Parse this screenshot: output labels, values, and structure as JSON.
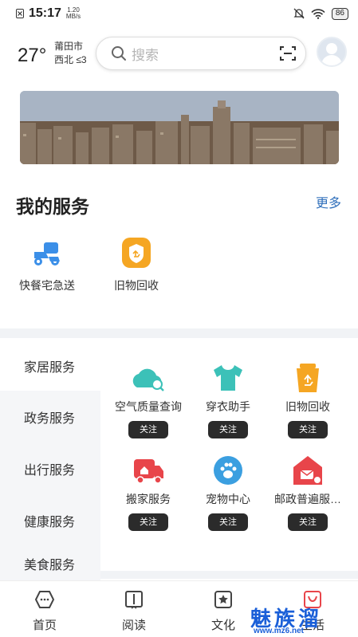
{
  "status_bar": {
    "time": "15:17",
    "net_speed_top": "1.20",
    "net_speed_bottom": "MB/s",
    "battery": "86"
  },
  "header": {
    "temperature": "27°",
    "city": "莆田市",
    "wind": "西北 ≤3",
    "search_placeholder": "搜索"
  },
  "my_services": {
    "title": "我的服务",
    "more_label": "更多",
    "items": [
      {
        "label": "快餐宅急送",
        "icon": "delivery-scooter-icon"
      },
      {
        "label": "旧物回收",
        "icon": "recycle-badge-icon"
      }
    ]
  },
  "categories": [
    {
      "label": "家居服务",
      "active": true
    },
    {
      "label": "政务服务",
      "active": false
    },
    {
      "label": "出行服务",
      "active": false
    },
    {
      "label": "健康服务",
      "active": false
    },
    {
      "label": "美食服务",
      "active": false
    }
  ],
  "grid": {
    "follow_label": "关注",
    "items": [
      {
        "label": "空气质量查询",
        "icon": "air-quality-icon"
      },
      {
        "label": "穿衣助手",
        "icon": "tshirt-icon"
      },
      {
        "label": "旧物回收",
        "icon": "recycle-bin-icon"
      },
      {
        "label": "搬家服务",
        "icon": "moving-truck-icon"
      },
      {
        "label": "宠物中心",
        "icon": "paw-icon"
      },
      {
        "label": "邮政普遍服…",
        "icon": "post-house-icon"
      }
    ]
  },
  "tabs": [
    {
      "label": "首页",
      "icon": "home-icon"
    },
    {
      "label": "阅读",
      "icon": "book-icon"
    },
    {
      "label": "文化",
      "icon": "culture-star-icon"
    },
    {
      "label": "生活",
      "icon": "life-bag-icon"
    }
  ],
  "watermark": {
    "brand": "魅族溜",
    "url": "www.mz6.net"
  },
  "colors": {
    "accent_blue": "#2f6fbb",
    "teal": "#3cc1b8",
    "orange": "#f5a623",
    "red": "#e8454a",
    "sky": "#3b9fe0"
  }
}
